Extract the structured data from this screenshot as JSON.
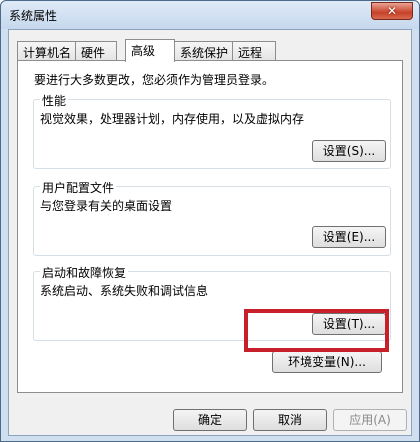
{
  "window": {
    "title": "系统属性",
    "close_label": "✕"
  },
  "tabs": [
    {
      "label": "计算机名",
      "active": false
    },
    {
      "label": "硬件",
      "active": false
    },
    {
      "label": "高级",
      "active": true
    },
    {
      "label": "系统保护",
      "active": false
    },
    {
      "label": "远程",
      "active": false
    }
  ],
  "advanced": {
    "notice": "要进行大多数更改，您必须作为管理员登录。",
    "performance": {
      "label": "性能",
      "description": "视觉效果，处理器计划，内存使用，以及虚拟内存",
      "button": "设置(S)..."
    },
    "user_profiles": {
      "label": "用户配置文件",
      "description": "与您登录有关的桌面设置",
      "button": "设置(E)..."
    },
    "startup_recovery": {
      "label": "启动和故障恢复",
      "description": "系统启动、系统失败和调试信息",
      "button": "设置(T)..."
    },
    "env_button": "环境变量(N)..."
  },
  "footer": {
    "ok": "确定",
    "cancel": "取消",
    "apply": "应用(A)"
  },
  "colors": {
    "highlight": "#c8202a"
  }
}
